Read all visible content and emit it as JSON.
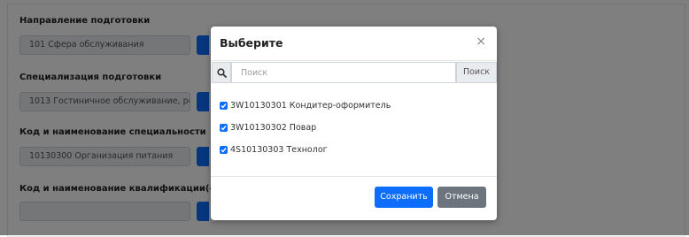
{
  "form": {
    "fields": [
      {
        "label": "Направление подготовки",
        "value": "101 Сфера обслуживания"
      },
      {
        "label": "Специализация подготовки",
        "value": "1013 Гостиничное обслуживание, рес"
      },
      {
        "label": "Код и наименование специальности",
        "value": "10130300 Организация питания"
      },
      {
        "label": "Код и наименование квалификации(-ий)",
        "value": ""
      }
    ]
  },
  "modal": {
    "title": "Выберите",
    "close_symbol": "×",
    "search": {
      "placeholder": "Поиск",
      "button_label": "Поиск"
    },
    "items": [
      {
        "label": "3W10130301 Кондитер-оформитель",
        "checked": true
      },
      {
        "label": "3W10130302 Повар",
        "checked": true
      },
      {
        "label": "4S10130303 Технолог",
        "checked": true
      }
    ],
    "save_label": "Сохранить",
    "cancel_label": "Отмена"
  },
  "colors": {
    "primary": "#0d6efd",
    "secondary": "#6c757d",
    "overlay": "rgba(0,0,0,0.5)"
  }
}
